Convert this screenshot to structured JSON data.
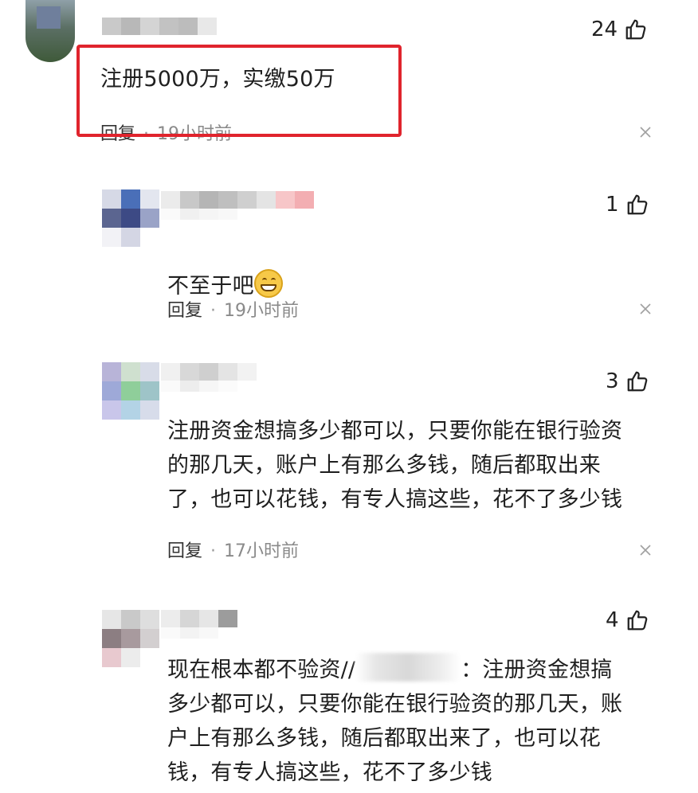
{
  "comments": [
    {
      "text": "注册5000万，实缴50万",
      "likes": "24",
      "reply_label": "回复",
      "time": "19小时前"
    },
    {
      "text": "不至于吧",
      "likes": "1",
      "reply_label": "回复",
      "time": "19小时前"
    },
    {
      "text": "注册资金想搞多少都可以，只要你能在银行验资\n的那几天，账户上有那么多钱，随后都取出来\n了，也可以花钱，有专人搞这些，花不了多少钱",
      "likes": "3",
      "reply_label": "回复",
      "time": "17小时前"
    },
    {
      "text_prefix": "现在根本都不验资//",
      "text_suffix": "：注册资金想搞",
      "text_rest": "多少都可以，只要你能在银行验资的那几天，账\n户上有那么多钱，随后都取出来了，也可以花\n钱，有专人搞这些，花不了多少钱",
      "likes": "4"
    }
  ],
  "colors": {
    "highlight": "#e0242d",
    "meta_time": "#8a8a8a"
  },
  "icons": {
    "like": "thumbs-up-icon",
    "close": "close-icon",
    "emoji": "grinning-face-icon"
  }
}
